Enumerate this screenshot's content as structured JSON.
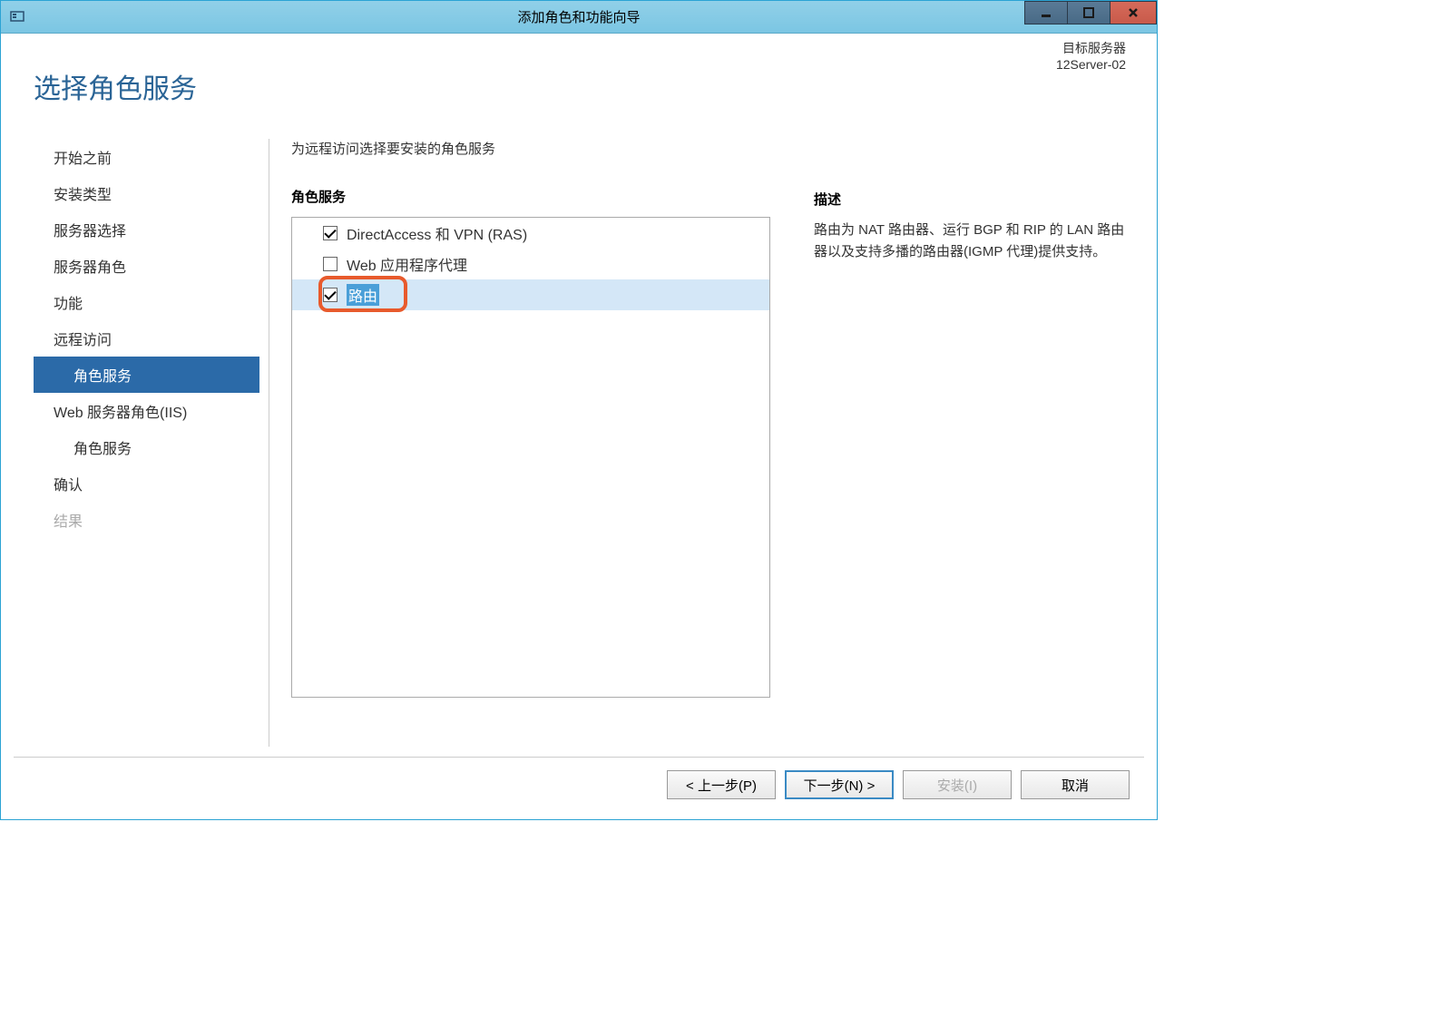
{
  "titlebar": {
    "title": "添加角色和功能向导"
  },
  "header": {
    "page_title": "选择角色服务",
    "target_server_label": "目标服务器",
    "target_server_name": "12Server-02"
  },
  "sidebar": {
    "items": [
      {
        "label": "开始之前",
        "indent": false,
        "active": false,
        "disabled": false
      },
      {
        "label": "安装类型",
        "indent": false,
        "active": false,
        "disabled": false
      },
      {
        "label": "服务器选择",
        "indent": false,
        "active": false,
        "disabled": false
      },
      {
        "label": "服务器角色",
        "indent": false,
        "active": false,
        "disabled": false
      },
      {
        "label": "功能",
        "indent": false,
        "active": false,
        "disabled": false
      },
      {
        "label": "远程访问",
        "indent": false,
        "active": false,
        "disabled": false
      },
      {
        "label": "角色服务",
        "indent": true,
        "active": true,
        "disabled": false
      },
      {
        "label": "Web 服务器角色(IIS)",
        "indent": false,
        "active": false,
        "disabled": false
      },
      {
        "label": "角色服务",
        "indent": true,
        "active": false,
        "disabled": false
      },
      {
        "label": "确认",
        "indent": false,
        "active": false,
        "disabled": false
      },
      {
        "label": "结果",
        "indent": false,
        "active": false,
        "disabled": true
      }
    ]
  },
  "main": {
    "instruction": "为远程访问选择要安装的角色服务",
    "section_header": "角色服务",
    "items": [
      {
        "label": "DirectAccess 和 VPN (RAS)",
        "checked": true,
        "selected": false,
        "highlighted": false
      },
      {
        "label": "Web 应用程序代理",
        "checked": false,
        "selected": false,
        "highlighted": false
      },
      {
        "label": "路由",
        "checked": true,
        "selected": true,
        "highlighted": true
      }
    ]
  },
  "description": {
    "header": "描述",
    "text": "路由为 NAT 路由器、运行 BGP 和 RIP 的 LAN 路由器以及支持多播的路由器(IGMP 代理)提供支持。"
  },
  "buttons": {
    "previous": "< 上一步(P)",
    "next": "下一步(N) >",
    "install": "安装(I)",
    "cancel": "取消"
  }
}
